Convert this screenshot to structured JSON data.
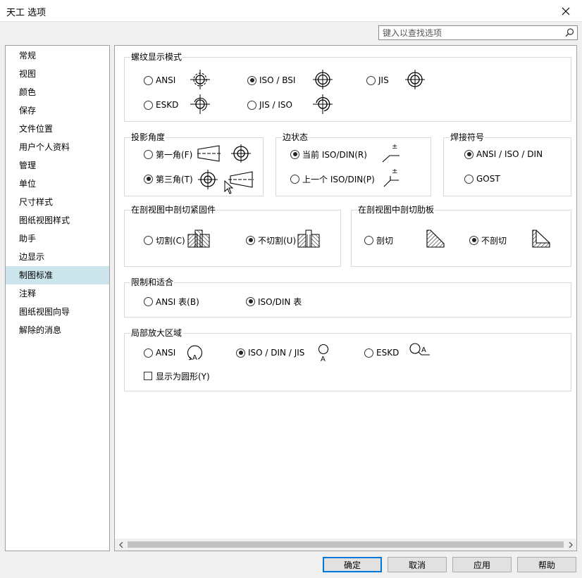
{
  "window": {
    "title": "天工 选项",
    "close_icon": "close-icon"
  },
  "search": {
    "placeholder": "键入以查找选项",
    "icon": "search-icon"
  },
  "sidebar": {
    "items": [
      {
        "label": "常规",
        "selected": false
      },
      {
        "label": "视图",
        "selected": false
      },
      {
        "label": "颜色",
        "selected": false
      },
      {
        "label": "保存",
        "selected": false
      },
      {
        "label": "文件位置",
        "selected": false
      },
      {
        "label": "用户个人资料",
        "selected": false
      },
      {
        "label": "管理",
        "selected": false
      },
      {
        "label": "单位",
        "selected": false
      },
      {
        "label": "尺寸样式",
        "selected": false
      },
      {
        "label": "图纸视图样式",
        "selected": false
      },
      {
        "label": "助手",
        "selected": false
      },
      {
        "label": "边显示",
        "selected": false
      },
      {
        "label": "制图标准",
        "selected": true
      },
      {
        "label": "注释",
        "selected": false
      },
      {
        "label": "图纸视图向导",
        "selected": false
      },
      {
        "label": "解除的消息",
        "selected": false
      }
    ]
  },
  "thread_display": {
    "title": "螺纹显示模式",
    "options": [
      {
        "label": "ANSI",
        "selected": false,
        "icon": "thread-ansi-icon"
      },
      {
        "label": "ISO / BSI",
        "selected": true,
        "icon": "thread-iso-bsi-icon"
      },
      {
        "label": "JIS",
        "selected": false,
        "icon": "thread-jis-icon"
      },
      {
        "label": "ESKD",
        "selected": false,
        "icon": "thread-eskd-icon"
      },
      {
        "label": "JIS / ISO",
        "selected": false,
        "icon": "thread-jis-iso-icon"
      }
    ]
  },
  "projection": {
    "title": "投影角度",
    "options": [
      {
        "label": "第一角(F)",
        "selected": false,
        "icon": "first-angle-icon"
      },
      {
        "label": "第三角(T)",
        "selected": true,
        "icon": "third-angle-icon"
      }
    ]
  },
  "edge_condition": {
    "title": "边状态",
    "options": [
      {
        "label": "当前 ISO/DIN(R)",
        "selected": true,
        "icon": "edge-current-icon"
      },
      {
        "label": "上一个 ISO/DIN(P)",
        "selected": false,
        "icon": "edge-previous-icon"
      }
    ],
    "symbol_text": "±"
  },
  "weld_symbol": {
    "title": "焊接符号",
    "options": [
      {
        "label": "ANSI / ISO / DIN",
        "selected": true
      },
      {
        "label": "GOST",
        "selected": false
      }
    ]
  },
  "section_fasteners": {
    "title": "在剖视图中剖切紧固件",
    "options": [
      {
        "label": "切割(C)",
        "selected": false,
        "icon": "fastener-cut-icon"
      },
      {
        "label": "不切割(U)",
        "selected": true,
        "icon": "fastener-nocut-icon"
      }
    ]
  },
  "section_ribs": {
    "title": "在剖视图中剖切肋板",
    "options": [
      {
        "label": "剖切",
        "selected": false,
        "icon": "rib-cut-icon"
      },
      {
        "label": "不剖切",
        "selected": true,
        "icon": "rib-nocut-icon"
      }
    ]
  },
  "limits_fits": {
    "title": "限制和适合",
    "options": [
      {
        "label": "ANSI 表(B)",
        "selected": false
      },
      {
        "label": "ISO/DIN 表",
        "selected": true
      }
    ]
  },
  "detail_area": {
    "title": "局部放大区域",
    "options": [
      {
        "label": "ANSI",
        "selected": false,
        "icon": "detail-ansi-icon"
      },
      {
        "label": "ISO / DIN / JIS",
        "selected": true,
        "icon": "detail-iso-icon"
      },
      {
        "label": "ESKD",
        "selected": false,
        "icon": "detail-eskd-icon"
      }
    ],
    "detail_letter": "A",
    "checkbox": {
      "label": "显示为圆形(Y)",
      "checked": false
    }
  },
  "buttons": {
    "ok": "确定",
    "cancel": "取消",
    "apply": "应用",
    "help": "帮助"
  }
}
